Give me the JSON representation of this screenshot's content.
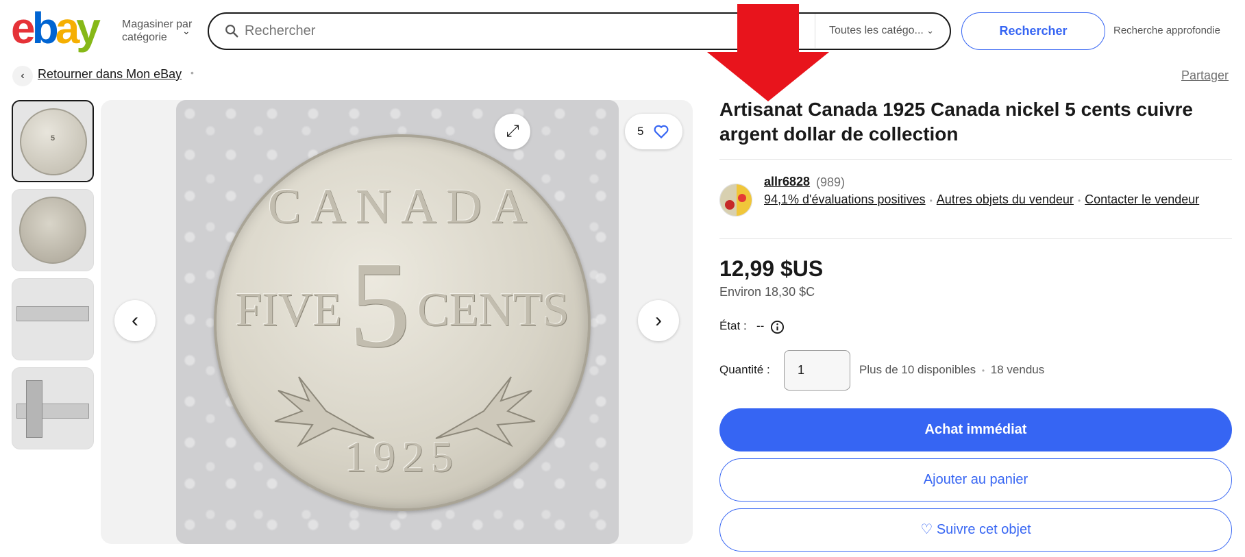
{
  "header": {
    "logo_letters": [
      "e",
      "b",
      "a",
      "y"
    ],
    "logo_colors": [
      "#e53238",
      "#0064d2",
      "#f5af02",
      "#86b817"
    ],
    "shop_by_category": "Magasiner par catégorie",
    "search_placeholder": "Rechercher",
    "category_select": "Toutes les catégo...",
    "search_button": "Rechercher",
    "advanced_search": "Recherche approfondie"
  },
  "breadcrumb": {
    "back_label": "Retourner dans Mon eBay",
    "share_label": "Partager"
  },
  "gallery": {
    "favorite_count": "5",
    "coin_top_text": "CANADA",
    "coin_five": "FIVE",
    "coin_number": "5",
    "coin_cents": "CENTS",
    "coin_year": "1925"
  },
  "listing": {
    "title": "Artisanat Canada 1925 Canada nickel 5 cents cuivre argent dollar de collection",
    "seller_name": "allr6828",
    "seller_score": "(989)",
    "positive_feedback": "94,1% d'évaluations positives",
    "other_items": "Autres objets du vendeur",
    "contact_seller": "Contacter le vendeur",
    "price": "12,99 $US",
    "approx_price": "Environ 18,30 $C",
    "condition_label": "État :",
    "condition_value": "--",
    "quantity_label": "Quantité :",
    "quantity_value": "1",
    "availability": "Plus de 10 disponibles",
    "sold": "18 vendus",
    "buy_now": "Achat immédiat",
    "add_to_cart": "Ajouter au panier",
    "watch": "♡ Suivre cet objet"
  },
  "colors": {
    "accent": "#3665f3",
    "arrow": "#e8141c"
  }
}
